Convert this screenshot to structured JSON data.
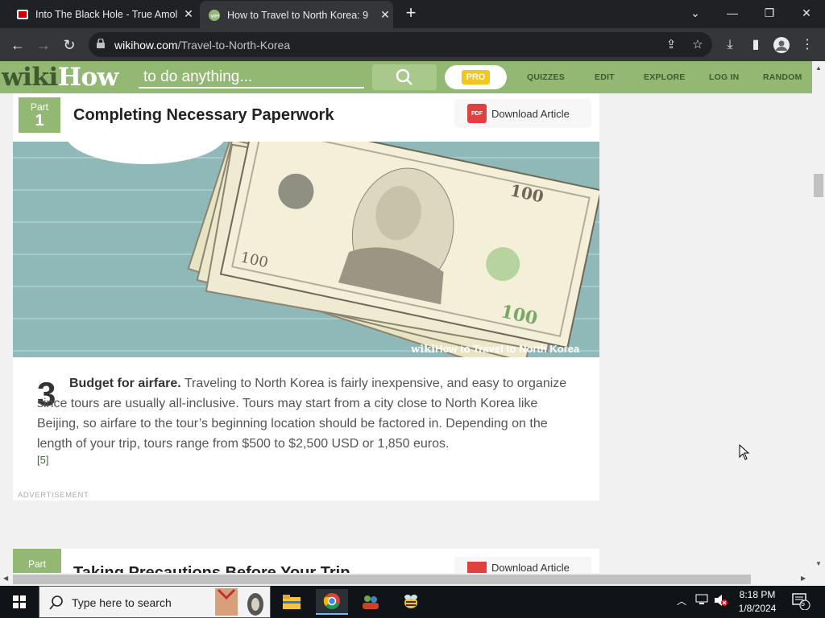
{
  "browser": {
    "tabs": [
      {
        "title": "Into The Black Hole - True Amole",
        "active": false
      },
      {
        "title": "How to Travel to North Korea: 9",
        "active": true
      }
    ],
    "new_tab": "+",
    "url_domain": "wikihow.com",
    "url_path": "/Travel-to-North-Korea"
  },
  "site": {
    "logo_wiki": "wiki",
    "logo_how": "How",
    "search_placeholder": "to do anything...",
    "pro_label": "PRO",
    "nav": [
      "QUIZZES",
      "EDIT",
      "EXPLORE",
      "LOG IN",
      "RANDOM"
    ]
  },
  "article": {
    "part_label": "Part",
    "part_number": "1",
    "part_title": "Completing Necessary Paperwork",
    "download_label": "Download Article",
    "pdf_label": "PDF",
    "watermark_wiki": "wiki",
    "watermark_how": "How",
    "watermark_text": " to Travel to North Korea",
    "step_number": "3",
    "step_bold": "Budget for airfare.",
    "step_body": " Traveling to North Korea is fairly inexpensive, and easy to organize since tours are usually all-inclusive. Tours may start from a city close to North Korea like Beijing, so airfare to the tour’s beginning location should be factored in. Depending on the length of your trip, tours range from $500 to $2,500 USD or 1,850 euros.",
    "reference": "[5]",
    "advertisement": "ADVERTISEMENT",
    "next_part_label": "Part",
    "next_part_title": "Taking Precautions Before Your Trip",
    "next_download_label": "Download Article"
  },
  "taskbar": {
    "search_placeholder": "Type here to search",
    "time": "8:18 PM",
    "date": "1/8/2024",
    "notification_count": "5"
  },
  "colors": {
    "wikihow_green": "#93b874",
    "wikihow_dark_green": "#3f5a2e",
    "chrome_dark": "#202124",
    "chrome_toolbar": "#35363a"
  }
}
